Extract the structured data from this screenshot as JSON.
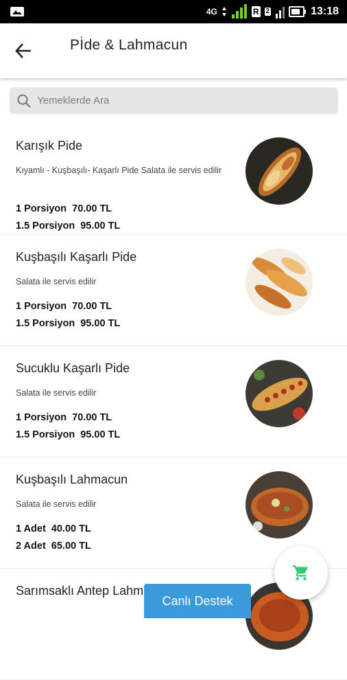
{
  "status_bar": {
    "network_type": "4G",
    "sim2_label": "R",
    "sim2_index": "2",
    "time": "13:18",
    "icons": [
      "gallery-icon",
      "signal-icon",
      "battery-icon"
    ]
  },
  "header": {
    "title": "Pİde & Lahmacun",
    "back_icon": "arrow-left-icon"
  },
  "search": {
    "placeholder": "Yemeklerde Ara",
    "value": ""
  },
  "menu_items": [
    {
      "name": "Karışık Pide",
      "description": "Kıyamlı - Kuşbaşılı- Kaşarlı Pide Salata ile servis edilir",
      "prices": [
        {
          "portion": "1 Porsiyon",
          "price": "70.00 TL"
        },
        {
          "portion": "1.5 Porsiyon",
          "price": "95.00 TL"
        }
      ]
    },
    {
      "name": "Kuşbaşılı Kaşarlı Pide",
      "description": "Salata ile servis edilir",
      "prices": [
        {
          "portion": "1 Porsiyon",
          "price": "70.00 TL"
        },
        {
          "portion": "1.5 Porsiyon",
          "price": "95.00 TL"
        }
      ]
    },
    {
      "name": "Sucuklu Kaşarlı Pide",
      "description": "Salata ile servis edilir",
      "prices": [
        {
          "portion": "1 Porsiyon",
          "price": "70.00 TL"
        },
        {
          "portion": "1.5 Porsiyon",
          "price": "95.00 TL"
        }
      ]
    },
    {
      "name": "Kuşbaşılı Lahmacun",
      "description": "Salata ile servis edilir",
      "prices": [
        {
          "portion": "1 Adet",
          "price": "40.00 TL"
        },
        {
          "portion": "2 Adet",
          "price": "65.00 TL"
        }
      ]
    },
    {
      "name": "Sarımsaklı Antep Lahm",
      "description": "",
      "prices": []
    }
  ],
  "cart_button": {
    "icon": "shopping-cart-icon",
    "color": "#2ecc71"
  },
  "support_button": {
    "label": "Canlı Destek",
    "color": "#3b9ad9"
  }
}
